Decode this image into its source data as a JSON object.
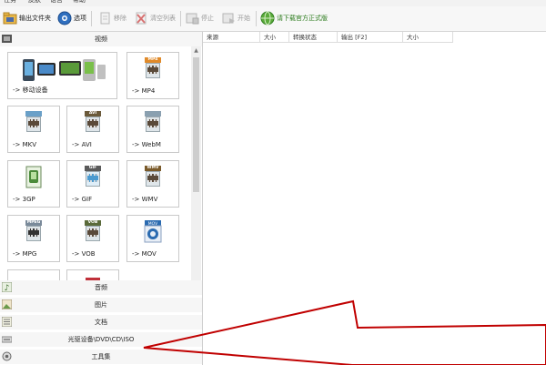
{
  "menu": [
    "任务",
    "皮肤",
    "语言",
    "帮助"
  ],
  "toolbar": {
    "output_folder": "输出文件夹",
    "options": "选项",
    "remove": "移除",
    "clear_list": "清空列表",
    "stop": "停止",
    "start": "开始",
    "download_official": "请下载官方正式版"
  },
  "left": {
    "video_header": "视频",
    "tiles": [
      {
        "label": "-> 移动设备",
        "icon": "mobile-devices-icon"
      },
      {
        "label": "-> MP4",
        "icon": "mp4-file-icon",
        "tag": "MP4",
        "color": "#e08a2a"
      },
      {
        "label": "-> MKV",
        "icon": "mkv-file-icon",
        "tag": "",
        "color": "#6aa0c8"
      },
      {
        "label": "-> AVI",
        "icon": "avi-file-icon",
        "tag": "AVI",
        "color": "#6b5a3a"
      },
      {
        "label": "-> WebM",
        "icon": "webm-file-icon",
        "tag": "",
        "color": "#8aa0b0"
      },
      {
        "label": "-> 3GP",
        "icon": "3gp-file-icon",
        "tag": "",
        "color": "#4a8a3a"
      },
      {
        "label": "-> GIF",
        "icon": "gif-file-icon",
        "tag": "GIF",
        "color": "#5a5a5a"
      },
      {
        "label": "-> WMV",
        "icon": "wmv-file-icon",
        "tag": "WMV",
        "color": "#7a5a2a"
      },
      {
        "label": "-> MPG",
        "icon": "mpg-file-icon",
        "tag": "MPEG",
        "color": "#7a8a9a"
      },
      {
        "label": "-> VOB",
        "icon": "vob-file-icon",
        "tag": "VOB",
        "color": "#5a6a3a"
      },
      {
        "label": "-> MOV",
        "icon": "mov-file-icon",
        "tag": "MOV",
        "color": "#2a6ab0"
      }
    ],
    "categories": [
      "音频",
      "图片",
      "文档",
      "光驱设备\\DVD\\CD\\ISO",
      "工具集"
    ]
  },
  "list": {
    "columns": [
      "来源",
      "大小",
      "转换状态",
      "输出 [F2]",
      "大小"
    ]
  },
  "colors": {
    "arrow": "#c00000",
    "download_text": "#2e7d1f"
  }
}
